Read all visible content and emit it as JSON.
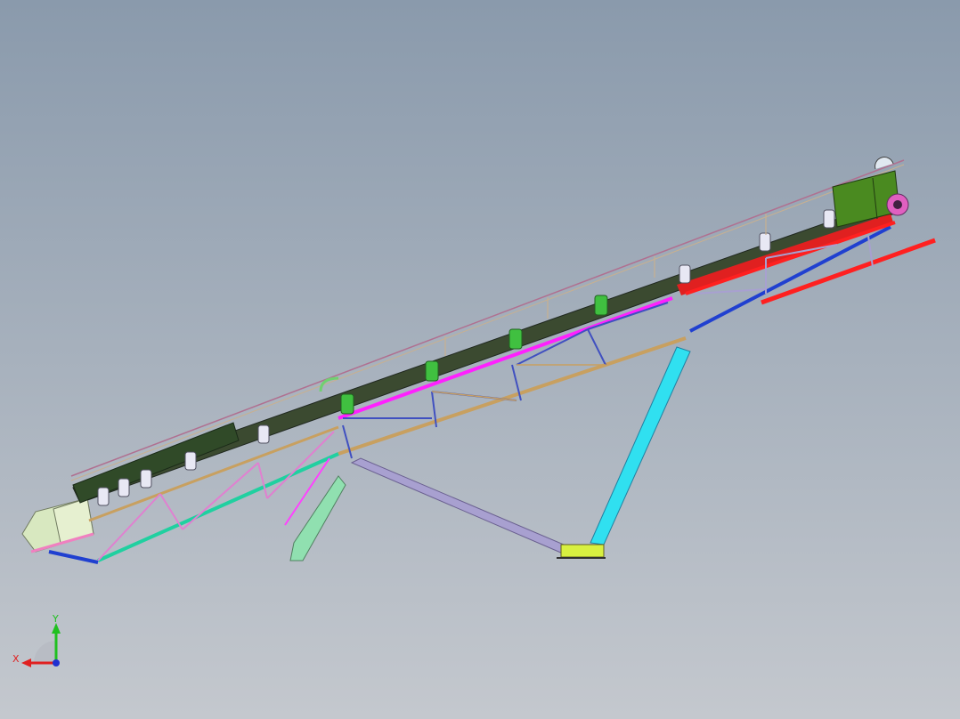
{
  "viewport": {
    "background_top": "#8a9aac",
    "background_bottom": "#c4c8ce"
  },
  "triad": {
    "x_label": "X",
    "y_label": "Y",
    "x_color": "#e02020",
    "y_color": "#20c020",
    "z_color": "#2030d0"
  },
  "parts": {
    "belt_color": "#3b4a30",
    "truss_colors": [
      "#ff20ff",
      "#c8a060",
      "#20d0a0",
      "#2040d0",
      "#ff2020",
      "#8080ff"
    ],
    "support_leg_color": "#30e0f0",
    "brace_color": "#a8a0d0",
    "motor_color": "#4a8a20",
    "hopper_color": "#d8e8c0",
    "idler_color": "#40c040",
    "chute_color": "#90e0b0"
  }
}
